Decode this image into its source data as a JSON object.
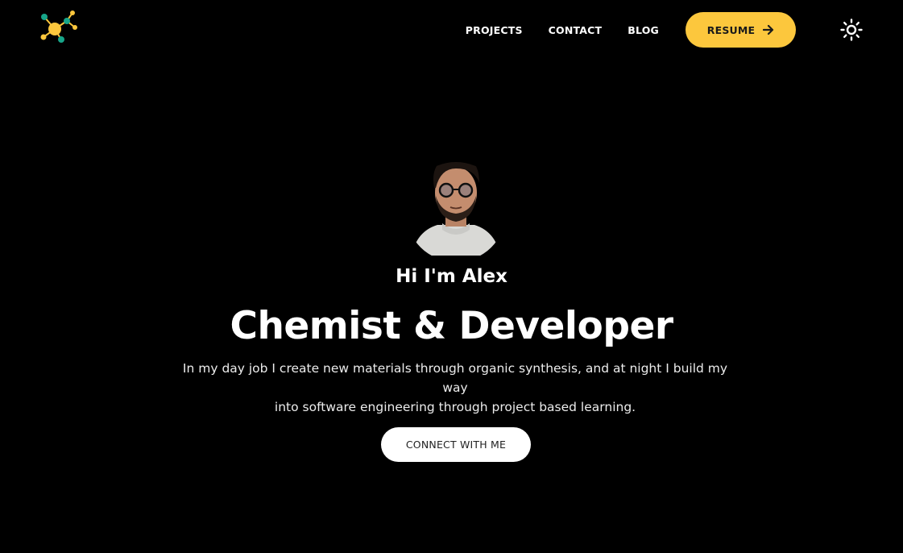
{
  "header": {
    "logo_icon": "molecule-icon",
    "nav": [
      {
        "label": "PROJECTS"
      },
      {
        "label": "CONTACT"
      },
      {
        "label": "BLOG"
      }
    ],
    "resume_button": {
      "label": "RESUME",
      "icon": "arrow-right-icon"
    },
    "theme_toggle_icon": "sun-icon"
  },
  "hero": {
    "avatar": "profile-photo",
    "greeting": "Hi I'm Alex",
    "headline": "Chemist & Developer",
    "bio_line_1": "In my day job I create new materials through organic synthesis, and at night I build my way",
    "bio_line_2": "into software engineering through project based learning.",
    "cta_label": "CONNECT WITH ME"
  },
  "colors": {
    "background": "#000000",
    "accent": "#fcc73d",
    "logo_teal": "#17a589",
    "text": "#ffffff"
  }
}
